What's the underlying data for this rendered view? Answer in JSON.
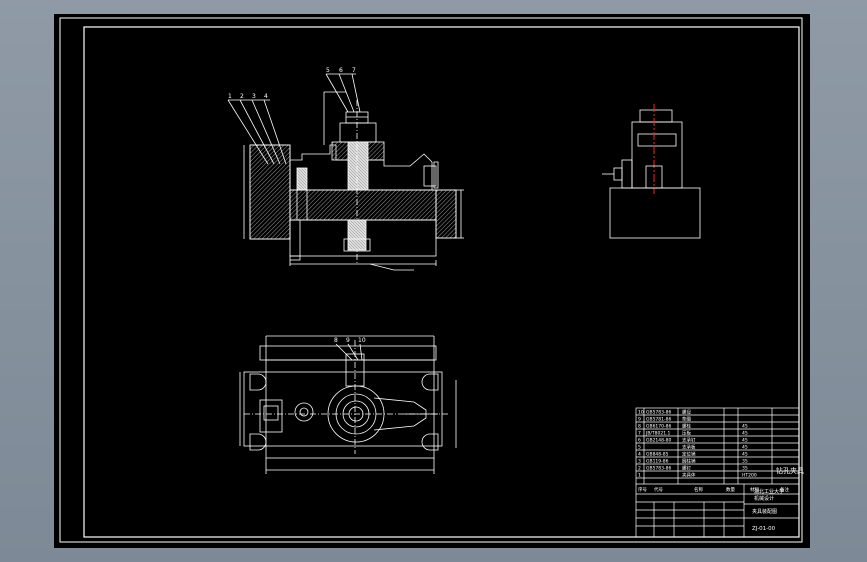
{
  "app": {
    "background_color": "#8a96a3",
    "canvas_color": "#000000"
  },
  "colors": {
    "line": "#ffffff",
    "centerline": "#ff2020",
    "hatch": "#cfcfcf"
  },
  "title_block": {
    "parts_list": [
      {
        "no": "10",
        "code": "GB5783-86",
        "name": "螺母",
        "qty": "",
        "material": ""
      },
      {
        "no": "9",
        "code": "GB5781-86",
        "name": "垫圈",
        "qty": "",
        "material": ""
      },
      {
        "no": "8",
        "code": "GB6170-86",
        "name": "螺栓",
        "qty": "",
        "material": "45"
      },
      {
        "no": "7",
        "code": "JB/T8021.1",
        "name": "压板",
        "qty": "",
        "material": "45"
      },
      {
        "no": "6",
        "code": "GB2148-80",
        "name": "支承钉",
        "qty": "",
        "material": "45"
      },
      {
        "no": "5",
        "code": "",
        "name": "支承板",
        "qty": "",
        "material": "45"
      },
      {
        "no": "4",
        "code": "GB848-85",
        "name": "定位销",
        "qty": "",
        "material": "45"
      },
      {
        "no": "3",
        "code": "GB119-86",
        "name": "圆柱销",
        "qty": "",
        "material": "35"
      },
      {
        "no": "2",
        "code": "GB5783-86",
        "name": "螺钉",
        "qty": "",
        "material": "35"
      },
      {
        "no": "1",
        "code": "",
        "name": "夹具体",
        "qty": "",
        "material": "HT200"
      }
    ],
    "header_labels": [
      "序号",
      "代号",
      "名称",
      "数量",
      "材料",
      "备注"
    ],
    "project_title": "钻孔夹具",
    "school_line_1": "湖北工业大学",
    "school_line_2": "机械设计",
    "drawing_name": "夹具装配图",
    "drawing_number": "ZJ-01-00",
    "small_labels": [
      "标记",
      "处数",
      "分区",
      "更改文件号",
      "签名",
      "日期",
      "设计",
      "审核",
      "工艺",
      "批准",
      "阶段标记",
      "重量",
      "比例"
    ]
  },
  "balloons": {
    "front_left": [
      "1",
      "2",
      "3",
      "4"
    ],
    "front_top": [
      "5",
      "6",
      "7"
    ],
    "top_view": [
      "8",
      "9",
      "10"
    ]
  }
}
